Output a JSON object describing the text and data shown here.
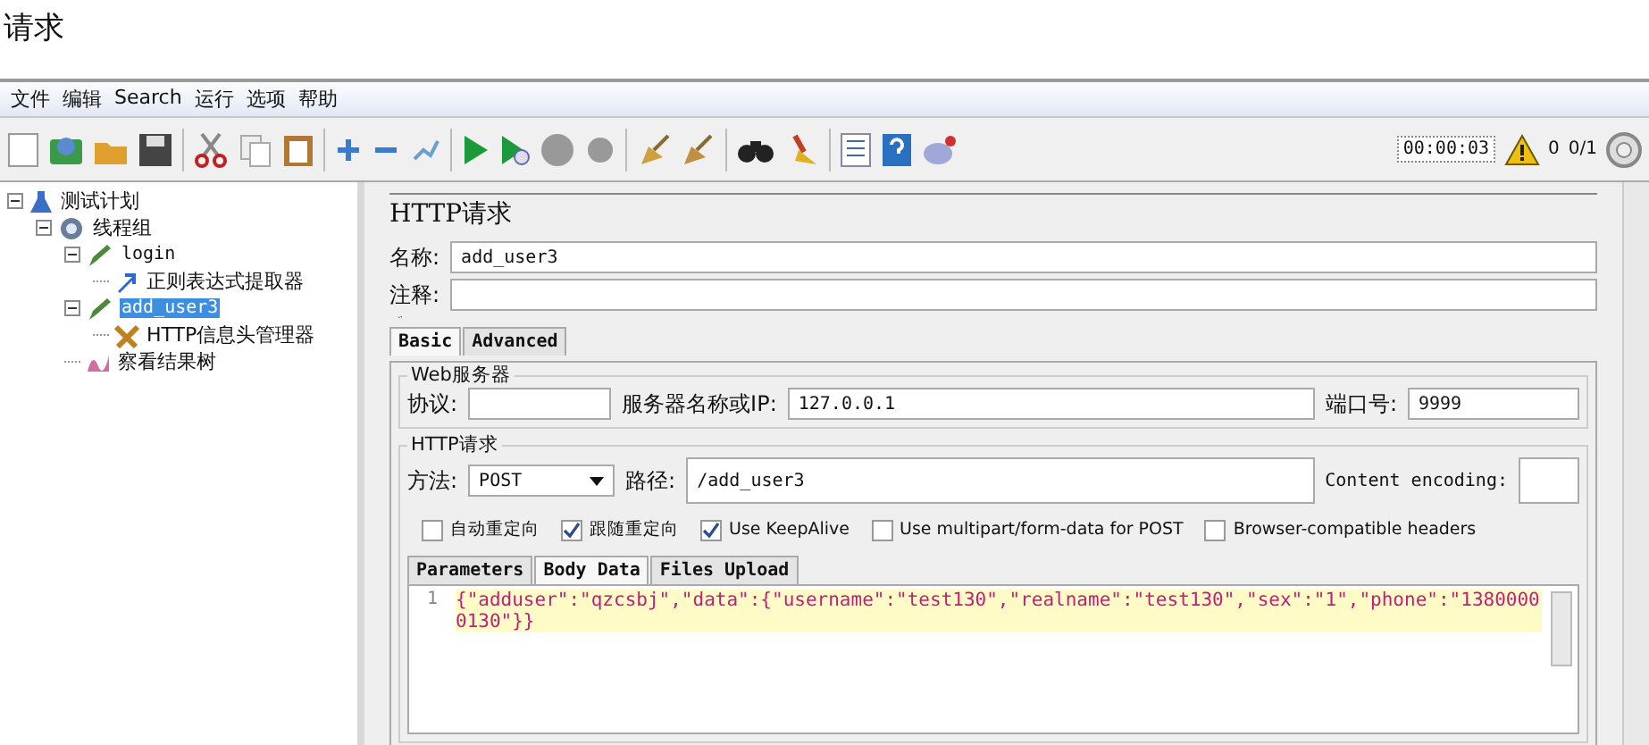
{
  "page_heading": "请求",
  "menu": [
    "文件",
    "编辑",
    "Search",
    "运行",
    "选项",
    "帮助"
  ],
  "toolbar": {
    "timer": "00:00:03",
    "warning_count": "0",
    "threads": "0/1"
  },
  "tree": [
    {
      "label": "测试计划",
      "kind": "plan",
      "expanded": true,
      "selected": false,
      "children": [
        {
          "label": "线程组",
          "kind": "group",
          "expanded": true,
          "selected": false,
          "children": [
            {
              "label": "login",
              "kind": "sampler",
              "expanded": true,
              "selected": false,
              "children": [
                {
                  "label": "正则表达式提取器",
                  "kind": "extractor",
                  "selected": false
                }
              ]
            },
            {
              "label": "add_user3",
              "kind": "sampler",
              "expanded": true,
              "selected": true,
              "children": [
                {
                  "label": "HTTP信息头管理器",
                  "kind": "config",
                  "selected": false
                }
              ]
            },
            {
              "label": "察看结果树",
              "kind": "listener",
              "selected": false
            }
          ]
        }
      ]
    }
  ],
  "panel": {
    "title": "HTTP请求",
    "name_label": "名称:",
    "name_value": "add_user3",
    "comment_label": "注释:",
    "tabs": [
      {
        "label": "Basic",
        "selected": true
      },
      {
        "label": "Advanced",
        "selected": false
      }
    ],
    "web_server": {
      "legend": "Web服务器",
      "protocol_label": "协议:",
      "server_label": "服务器名称或IP:",
      "server_value": "127.0.0.1",
      "port_label": "端口号:",
      "port_value": "9999"
    },
    "http_request": {
      "legend": "HTTP请求",
      "method_label": "方法:",
      "method_value": "POST",
      "path_label": "路径:",
      "path_value": "/add_user3",
      "encoding_label": "Content encoding:",
      "options": [
        {
          "label": "自动重定向",
          "checked": false
        },
        {
          "label": "跟随重定向",
          "checked": true
        },
        {
          "label": "Use KeepAlive",
          "checked": true
        },
        {
          "label": "Use multipart/form-data for POST",
          "checked": false
        },
        {
          "label": "Browser-compatible headers",
          "checked": false
        }
      ],
      "body_tabs": [
        {
          "label": "Parameters",
          "selected": false
        },
        {
          "label": "Body Data",
          "selected": true
        },
        {
          "label": "Files Upload",
          "selected": false
        }
      ],
      "code_lines": [
        {
          "number": "1",
          "text": "{\"adduser\":\"qzcsbj\",\"data\":{\"username\":\"test130\",\"realname\":\"test130\",\"sex\":\"1\",\"phone\":\"13800000130\"}}"
        }
      ]
    }
  }
}
